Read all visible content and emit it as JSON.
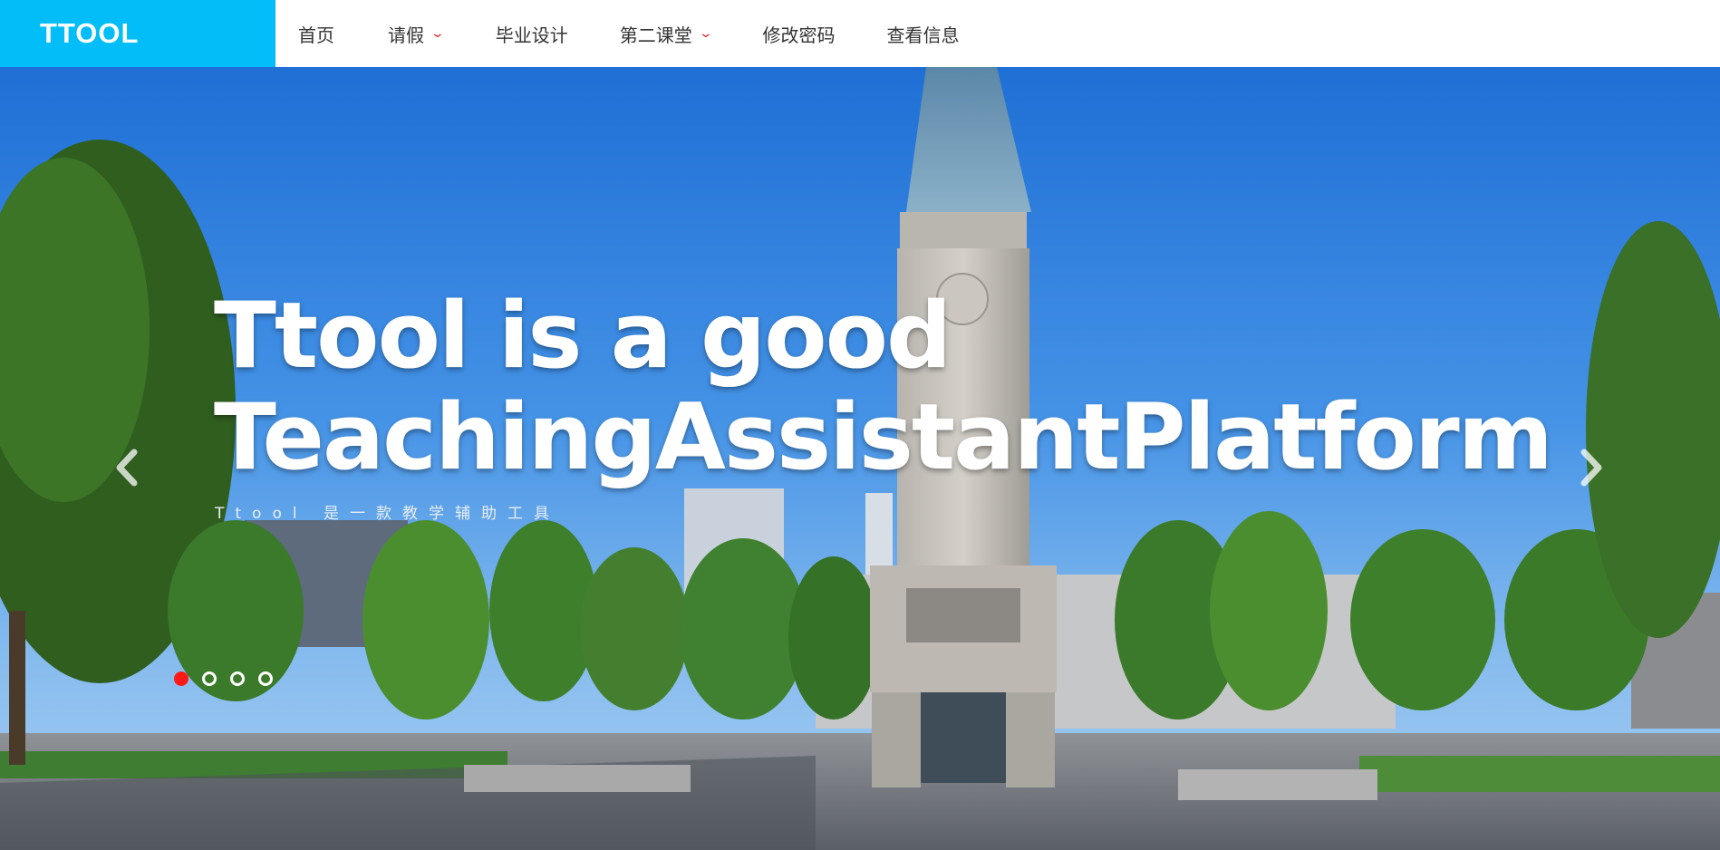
{
  "header": {
    "logo": "TTOOL",
    "nav": [
      {
        "label": "首页",
        "has_dropdown": false
      },
      {
        "label": "请假",
        "has_dropdown": true
      },
      {
        "label": "毕业设计",
        "has_dropdown": false
      },
      {
        "label": "第二课堂",
        "has_dropdown": true
      },
      {
        "label": "修改密码",
        "has_dropdown": false
      },
      {
        "label": "查看信息",
        "has_dropdown": false
      }
    ]
  },
  "hero": {
    "title_line1": "Ttool is a good",
    "title_line2": "TeachingAssistantPlatform",
    "subtitle": "Ttool 是一款教学辅助工具",
    "prev_icon": "chevron-left-icon",
    "next_icon": "chevron-right-icon",
    "slides_count": 4,
    "active_slide": 1
  },
  "colors": {
    "brand": "#02bdf7",
    "nav_text": "#333333",
    "dropdown_chevron": "#e02424",
    "active_dot": "#ff1a1a"
  }
}
